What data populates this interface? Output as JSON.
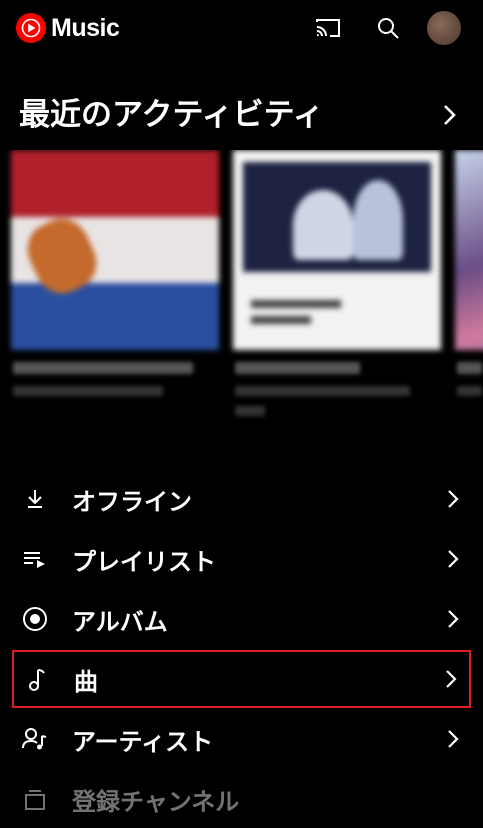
{
  "app": {
    "name": "Music"
  },
  "header": {
    "section_title": "最近のアクティビティ"
  },
  "recent": [
    {
      "title": "",
      "subtitle": ""
    },
    {
      "title": "",
      "subtitle": ""
    },
    {
      "title": "",
      "subtitle": ""
    }
  ],
  "library": [
    {
      "label": "オフライン",
      "icon": "download-icon"
    },
    {
      "label": "プレイリスト",
      "icon": "playlist-icon"
    },
    {
      "label": "アルバム",
      "icon": "album-icon"
    },
    {
      "label": "曲",
      "icon": "music-note-icon"
    },
    {
      "label": "アーティスト",
      "icon": "artist-icon"
    },
    {
      "label": "登録チャンネル",
      "icon": "subscriptions-icon"
    }
  ],
  "colors": {
    "background": "#000000",
    "brand_red": "#ff0000",
    "highlight_border": "#e01c1c"
  }
}
